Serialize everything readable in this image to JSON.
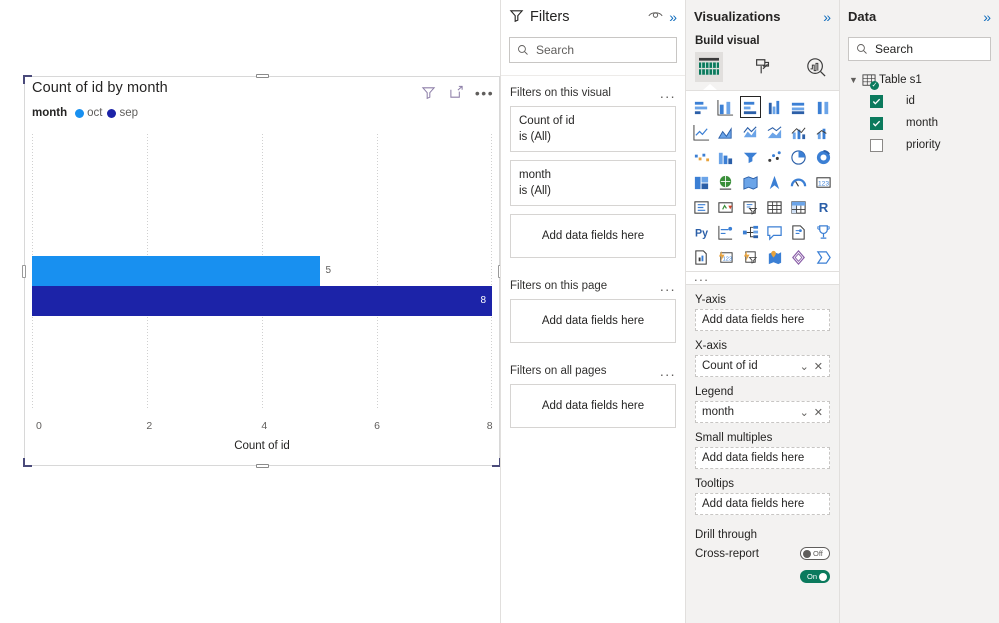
{
  "canvas": {
    "visual": {
      "title": "Count of id by month",
      "actions": [
        "filter-icon",
        "focus-mode-icon",
        "more-options-icon"
      ],
      "legend_title": "month"
    }
  },
  "chart_data": {
    "type": "bar",
    "orientation": "horizontal",
    "title": "Count of id by month",
    "categories": [
      "oct",
      "sep"
    ],
    "values": [
      5,
      8
    ],
    "series": [
      {
        "name": "oct",
        "values": [
          5
        ],
        "color": "#1890f0"
      },
      {
        "name": "sep",
        "values": [
          8
        ],
        "color": "#1c23a8"
      }
    ],
    "data_labels": [
      "5",
      "8"
    ],
    "xlabel": "Count of id",
    "ylabel": "",
    "xticks": [
      "0",
      "2",
      "4",
      "6",
      "8"
    ],
    "xlim": [
      0,
      8
    ],
    "grid": true,
    "legend_position": "top",
    "legend_title": "month"
  },
  "filters_panel": {
    "title": "Filters",
    "hide_icon": "eye-icon",
    "collapse_icon": "chevron-double-right-icon",
    "search": {
      "placeholder": "Search",
      "icon": "search-icon"
    },
    "groups": [
      {
        "heading": "Filters on this visual",
        "more": "...",
        "cards": [
          {
            "field": "Count of id",
            "condition": "is (All)"
          },
          {
            "field": "month",
            "condition": "is (All)"
          }
        ],
        "dropzone": "Add data fields here"
      },
      {
        "heading": "Filters on this page",
        "more": "...",
        "cards": [],
        "dropzone": "Add data fields here"
      },
      {
        "heading": "Filters on all pages",
        "more": "...",
        "cards": [],
        "dropzone": "Add data fields here"
      }
    ]
  },
  "visualizations_panel": {
    "title": "Visualizations",
    "collapse_icon": "chevron-double-right-icon",
    "build_label": "Build visual",
    "tabs": [
      {
        "name": "build-visual-tab",
        "icon": "build-visual-icon",
        "active": true
      },
      {
        "name": "format-visual-tab",
        "icon": "paint-roller-icon",
        "active": false
      },
      {
        "name": "analytics-tab",
        "icon": "analytics-magnifier-icon",
        "active": false
      }
    ],
    "icon_grid_more": "...",
    "selected_visual_index": 2,
    "wells": [
      {
        "label": "Y-axis",
        "value": "Add data fields here",
        "filled": false
      },
      {
        "label": "X-axis",
        "value": "Count of id",
        "filled": true
      },
      {
        "label": "Legend",
        "value": "month",
        "filled": true
      },
      {
        "label": "Small multiples",
        "value": "Add data fields here",
        "filled": false
      },
      {
        "label": "Tooltips",
        "value": "Add data fields here",
        "filled": false
      }
    ],
    "drill_through": {
      "label": "Drill through",
      "cross_report": {
        "label": "Cross-report",
        "state": "Off",
        "on": false
      },
      "keep_all_filters": {
        "label": "",
        "state": "On",
        "on": true
      }
    }
  },
  "data_panel": {
    "title": "Data",
    "collapse_icon": "chevron-double-right-icon",
    "search": {
      "placeholder": "Search",
      "icon": "search-icon"
    },
    "table": {
      "name": "Table s1",
      "expanded": true,
      "icon": "table-icon",
      "fields": [
        {
          "name": "id",
          "checked": true
        },
        {
          "name": "month",
          "checked": true
        },
        {
          "name": "priority",
          "checked": false
        }
      ]
    }
  },
  "colors": {
    "accent": "#0f6cbd",
    "bar_light": "#1890f0",
    "bar_dark": "#1c23a8",
    "check_green": "#0b7a5d",
    "panel_bg": "#f3f2f1"
  }
}
